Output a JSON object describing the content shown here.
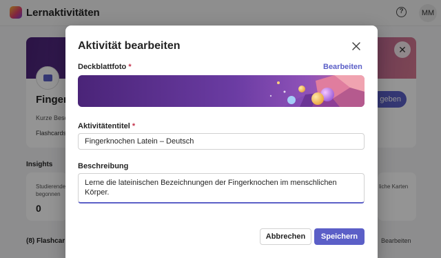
{
  "app": {
    "title": "Lernaktivitäten",
    "help_symbol": "?",
    "avatar_initials": "MM"
  },
  "background": {
    "card_title": "Finger",
    "card_description": "Kurze Besc",
    "card_tag": "Flashcards",
    "share_button": "geben",
    "close_symbol": "✕",
    "insights_label": "Insights",
    "insight_left_text_1": "Studierende",
    "insight_left_text_2": "begonnen",
    "insight_left_value": "0",
    "insight_right_text": "liche Karten",
    "flashcards_label": "(8) Flashcar",
    "flashcards_edit": "Bearbeiten"
  },
  "dialog": {
    "title": "Aktivität bearbeiten",
    "cover_label": "Deckblattfoto",
    "required_mark": "*",
    "cover_edit": "Bearbeiten",
    "title_label": "Aktivitätentitel",
    "title_value": "Fingerknochen Latein – Deutsch",
    "description_label": "Beschreibung",
    "description_value": "Lerne die lateinischen Bezeichnungen der Fingerknochen im menschlichen Körper.",
    "cancel_button": "Abbrechen",
    "save_button": "Speichern"
  },
  "colors": {
    "accent": "#5b5fc7",
    "required": "#c4314b",
    "scrim": "rgba(0,0,0,0.42)"
  }
}
